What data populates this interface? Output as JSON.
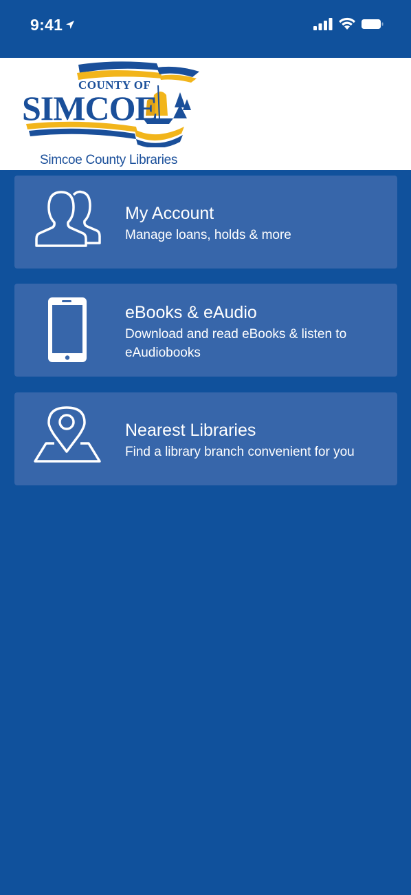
{
  "status_bar": {
    "time": "9:41",
    "location_icon": "location-arrow-icon",
    "signal_icon": "cellular-signal-icon",
    "wifi_icon": "wifi-icon",
    "battery_icon": "battery-icon"
  },
  "header": {
    "logo": {
      "county_of": "COUNTY OF",
      "simcoe": "SIMCOE",
      "colors": {
        "blue": "#1a4f9a",
        "gold": "#f2b51b"
      }
    },
    "subtitle": "Simcoe County Libraries"
  },
  "menu": {
    "items": [
      {
        "icon": "users-icon",
        "title": "My Account",
        "description": "Manage loans, holds & more"
      },
      {
        "icon": "mobile-device-icon",
        "title": "eBooks & eAudio",
        "description": "Download and read eBooks & listen to eAudiobooks"
      },
      {
        "icon": "map-pin-icon",
        "title": "Nearest Libraries",
        "description": "Find a library branch convenient for you"
      }
    ]
  },
  "colors": {
    "background": "#10519c",
    "card": "#3766aa",
    "text": "#ffffff"
  }
}
